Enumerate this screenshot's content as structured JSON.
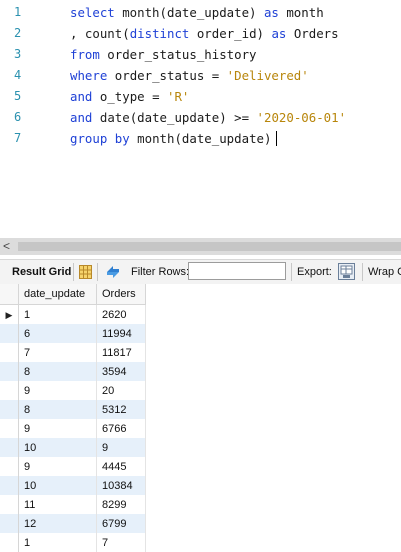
{
  "editor": {
    "line_numbers": [
      "1",
      "2",
      "3",
      "4",
      "5",
      "6",
      "7"
    ],
    "lines": [
      {
        "t": [
          {
            "k": "kw",
            "v": "select "
          },
          {
            "k": "fn",
            "v": "month"
          },
          {
            "k": "",
            "v": "(date_update) "
          },
          {
            "k": "kw",
            "v": "as"
          },
          {
            "k": "",
            "v": " month"
          }
        ]
      },
      {
        "t": [
          {
            "k": "",
            "v": ", "
          },
          {
            "k": "fn",
            "v": "count"
          },
          {
            "k": "",
            "v": "("
          },
          {
            "k": "kw",
            "v": "distinct"
          },
          {
            "k": "",
            "v": " order_id) "
          },
          {
            "k": "kw",
            "v": "as"
          },
          {
            "k": "",
            "v": " Orders"
          }
        ]
      },
      {
        "t": [
          {
            "k": "kw",
            "v": "from"
          },
          {
            "k": "",
            "v": " order_status_history"
          }
        ]
      },
      {
        "t": [
          {
            "k": "kw",
            "v": "where"
          },
          {
            "k": "",
            "v": " order_status = "
          },
          {
            "k": "str",
            "v": "'Delivered'"
          }
        ]
      },
      {
        "t": [
          {
            "k": "kw",
            "v": "and"
          },
          {
            "k": "",
            "v": " o_type = "
          },
          {
            "k": "str",
            "v": "'R'"
          }
        ]
      },
      {
        "t": [
          {
            "k": "kw",
            "v": "and"
          },
          {
            "k": "",
            "v": " "
          },
          {
            "k": "fn",
            "v": "date"
          },
          {
            "k": "",
            "v": "(date_update) >= "
          },
          {
            "k": "str",
            "v": "'2020-06-01'"
          }
        ]
      },
      {
        "t": [
          {
            "k": "kw",
            "v": "group by"
          },
          {
            "k": "",
            "v": " "
          },
          {
            "k": "fn",
            "v": "month"
          },
          {
            "k": "",
            "v": "(date_update)"
          }
        ]
      }
    ]
  },
  "scrollbar": {
    "left_arrow": "<"
  },
  "toolbar": {
    "result_grid_label": "Result Grid",
    "filter_label": "Filter Rows:",
    "filter_value": "",
    "export_label": "Export:",
    "wrap_label": "Wrap C"
  },
  "grid": {
    "columns": [
      "date_update",
      "Orders"
    ],
    "current_row_marker": "▶",
    "rows": [
      [
        "1",
        "2620"
      ],
      [
        "6",
        "11994"
      ],
      [
        "7",
        "11817"
      ],
      [
        "8",
        "3594"
      ],
      [
        "9",
        "20"
      ],
      [
        "8",
        "5312"
      ],
      [
        "9",
        "6766"
      ],
      [
        "10",
        "9"
      ],
      [
        "9",
        "4445"
      ],
      [
        "10",
        "10384"
      ],
      [
        "11",
        "8299"
      ],
      [
        "12",
        "6799"
      ],
      [
        "1",
        "7"
      ]
    ]
  }
}
